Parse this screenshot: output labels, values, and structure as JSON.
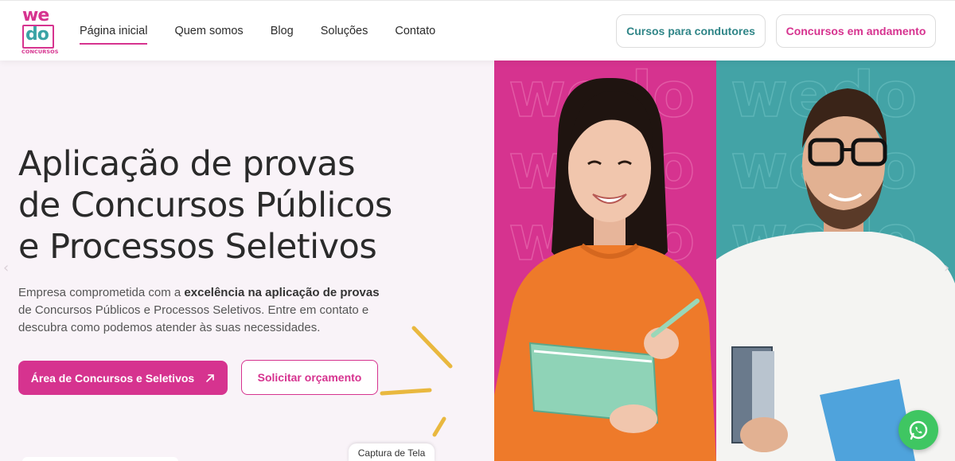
{
  "logo": {
    "line1": "we",
    "line2": "do",
    "sub": "CONCURSOS"
  },
  "nav": {
    "items": [
      {
        "label": "Página inicial",
        "active": true
      },
      {
        "label": "Quem somos"
      },
      {
        "label": "Blog"
      },
      {
        "label": "Soluções"
      },
      {
        "label": "Contato"
      }
    ]
  },
  "header_buttons": {
    "drivers": "Cursos para condutores",
    "ongoing": "Concursos em andamento"
  },
  "hero": {
    "title_lines": [
      "Aplicação de provas",
      "de Concursos Públicos",
      "e Processos Seletivos"
    ],
    "desc_pre": "Empresa comprometida com a ",
    "desc_bold": "excelência na aplicação de provas",
    "desc_post": " de Concursos Públicos e Processos Seletivos. Entre em contato e descubra como podemos atender às suas necessidades.",
    "primary_button": "Área de Concursos e Seletivos",
    "secondary_button": "Solicitar orçamento"
  },
  "watermark": "wedo",
  "capture_label": "Captura de Tela",
  "colors": {
    "brand_pink": "#d6338f",
    "brand_teal": "#43a3a6",
    "whatsapp": "#3fc662"
  }
}
